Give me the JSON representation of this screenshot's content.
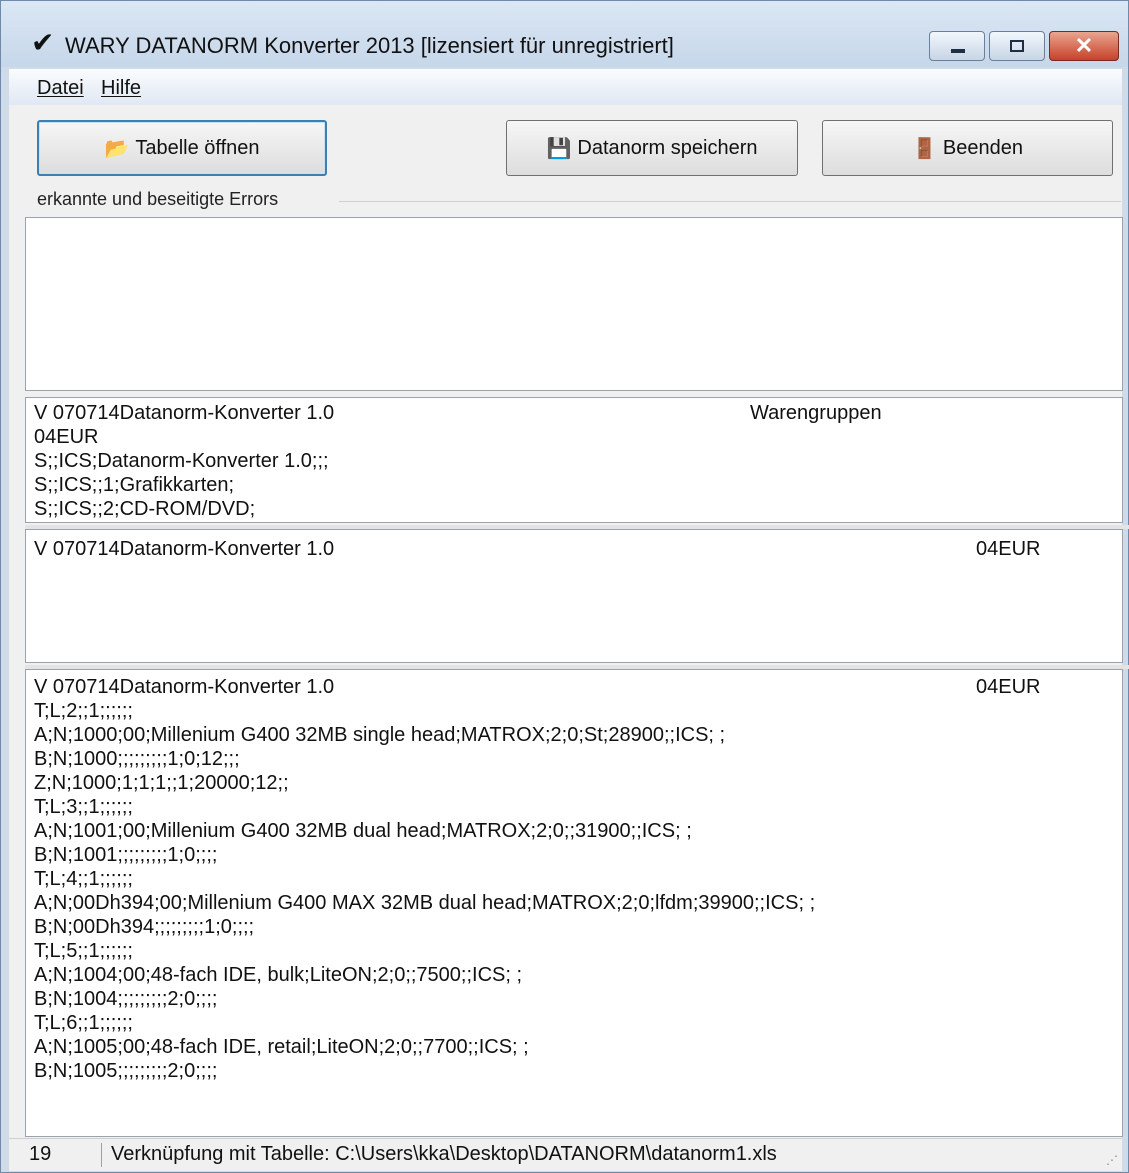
{
  "window": {
    "title": "WARY DATANORM Konverter 2013 [lizensiert für unregistriert]",
    "title_icon": "check-icon",
    "minimize_glyph": "",
    "maximize_glyph": "",
    "close_glyph": "✕"
  },
  "menu": {
    "datei": "Datei",
    "hilfe": "Hilfe"
  },
  "toolbar": {
    "open_label": "Tabelle öffnen",
    "save_label": "Datanorm speichern",
    "exit_label": "Beenden"
  },
  "errors": {
    "label": "erkannte und beseitigte Errors",
    "content": ""
  },
  "pane1": {
    "lines": [
      "V 070714Datanorm-Konverter 1.0",
      "04EUR",
      "S;;ICS;Datanorm-Konverter 1.0;;;",
      "S;;ICS;;1;Grafikkarten;",
      "S;;ICS;;2;CD-ROM/DVD;"
    ],
    "right": "Warengruppen"
  },
  "pane2": {
    "lines": [
      "V 070714Datanorm-Konverter 1.0"
    ],
    "right": "04EUR"
  },
  "pane3": {
    "lines": [
      "V 070714Datanorm-Konverter 1.0",
      "T;L;2;;1;;;;;;",
      "A;N;1000;00;Millenium G400 32MB single head;MATROX;2;0;St;28900;;ICS; ;",
      "B;N;1000;;;;;;;;;1;0;12;;;",
      "Z;N;1000;1;1;1;;1;20000;12;;",
      "T;L;3;;1;;;;;;",
      "A;N;1001;00;Millenium G400 32MB dual head;MATROX;2;0;;31900;;ICS; ;",
      "B;N;1001;;;;;;;;;1;0;;;;",
      "T;L;4;;1;;;;;;",
      "A;N;00Dh394;00;Millenium G400 MAX 32MB dual head;MATROX;2;0;lfdm;39900;;ICS; ;",
      "B;N;00Dh394;;;;;;;;;1;0;;;;",
      "T;L;5;;1;;;;;;",
      "A;N;1004;00;48-fach IDE, bulk;LiteON;2;0;;7500;;ICS; ;",
      "B;N;1004;;;;;;;;;2;0;;;;",
      "T;L;6;;1;;;;;;",
      "A;N;1005;00;48-fach IDE, retail;LiteON;2;0;;7700;;ICS; ;",
      "B;N;1005;;;;;;;;;2;0;;;;"
    ],
    "right": "04EUR"
  },
  "status": {
    "count": "19",
    "text": "Verknüpfung mit Tabelle: C:\\Users\\kka\\Desktop\\DATANORM\\datanorm1.xls"
  }
}
